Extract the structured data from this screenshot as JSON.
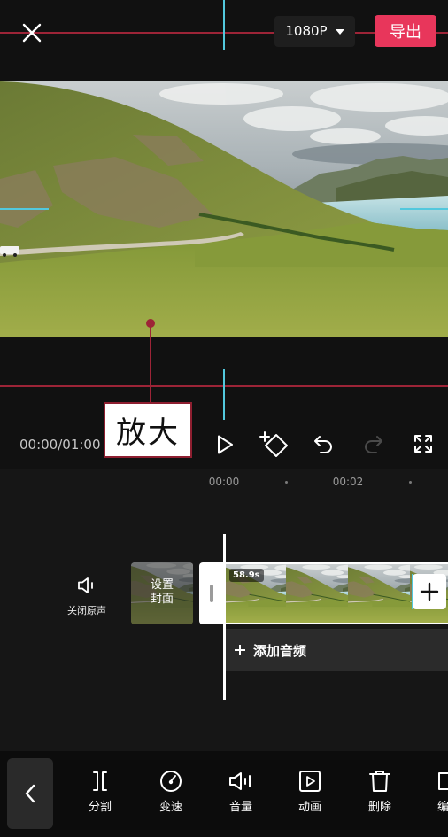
{
  "header": {
    "close_icon": "close-icon",
    "resolution": "1080P",
    "resolution_caret_icon": "caret-down-icon",
    "export_label": "导出"
  },
  "annotation": {
    "label": "放大"
  },
  "playback_controls": {
    "time_display": "00:00/01:00",
    "play_icon": "play-icon",
    "keyframe_icon": "add-keyframe-icon",
    "undo_icon": "undo-icon",
    "redo_icon": "redo-icon",
    "redo_enabled": false,
    "fullscreen_icon": "fullscreen-icon"
  },
  "ruler": {
    "ticks": [
      "00:00",
      "00:02"
    ]
  },
  "tracks": {
    "mute_icon": "speaker-mute-icon",
    "mute_label": "关闭原声",
    "cover_label_lines": [
      "设置",
      "封面"
    ],
    "clip_duration": "58.9s",
    "add_clip_icon": "plus-icon",
    "add_audio_icon": "plus-icon",
    "add_audio_label": "添加音频"
  },
  "toolbar": {
    "back_icon": "chevron-left-icon",
    "items": [
      {
        "label": "分割",
        "icon": "split-icon"
      },
      {
        "label": "变速",
        "icon": "speed-icon"
      },
      {
        "label": "音量",
        "icon": "volume-icon"
      },
      {
        "label": "动画",
        "icon": "animation-icon"
      },
      {
        "label": "删除",
        "icon": "delete-icon"
      },
      {
        "label": "编",
        "icon": "edit-icon"
      }
    ]
  },
  "colors": {
    "background": "#111111",
    "timeline_background": "#161616",
    "export_button": "#e8365b",
    "annotation_red": "#9d2437",
    "guide_cyan": "#52c8dd"
  }
}
